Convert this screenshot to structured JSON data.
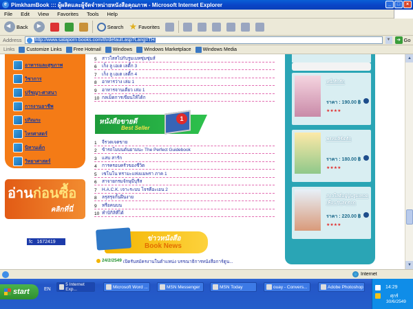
{
  "window": {
    "title": "PimkhamBook ::: ผู้ผลิตและผู้จัดจำหน่ายหนังสือคุณภาพ - Microsoft Internet Explorer"
  },
  "menu": [
    "File",
    "Edit",
    "View",
    "Favorites",
    "Tools",
    "Help"
  ],
  "toolbar": {
    "back": "Back",
    "search": "Search",
    "favorites": "Favorites"
  },
  "address": {
    "label": "Address",
    "url": "http://www.sataporn books.com/th/default.asp?Lang=TH",
    "go": "Go"
  },
  "links": {
    "label": "Links",
    "items": [
      "Customize Links",
      "Free Hotmail",
      "Windows",
      "Windows Marketplace",
      "Windows Media"
    ]
  },
  "categories": [
    "อาหารและสุขภาพ",
    "วิชาการ",
    "ปรัชญา-ศาสนา",
    "การงานอาชีพ",
    "ปกิณกะ",
    "ไหรศาสตร์",
    "นิทานเด็ก",
    "วิทยาศาสตร์"
  ],
  "promo": {
    "big_a": "อ่าน",
    "big_b": "ก่อนซื้อ",
    "sub": "คลิกที่นี่"
  },
  "counter": {
    "icon": "fc",
    "value": "1672419"
  },
  "list_top": [
    {
      "n": "5",
      "t": "สาวใสสไปกับรูมเมทซุ่มซุ่มส์"
    },
    {
      "n": "6",
      "t": "เก็ง ลู เอเต เลดี้ก 3"
    },
    {
      "n": "7",
      "t": "เก็ง ลู เอเต เลดี้ก 4"
    },
    {
      "n": "8",
      "t": "อาหารว่าง เล่ม 1"
    },
    {
      "n": "9",
      "t": "อาหารจานเดียว เล่ม 1"
    },
    {
      "n": "10",
      "t": "กลเม็ดการเขียนให้ได้ก"
    }
  ],
  "bestseller": {
    "title": "หนังสือขายดี",
    "subtitle": "Best Seller",
    "badge": "1"
  },
  "list_best": [
    {
      "n": "1",
      "t": "จีรวดเจตขาย"
    },
    {
      "n": "2",
      "t": "ข้ารถโมบนดันยามนะ The Perfect Guidebook"
    },
    {
      "n": "3",
      "t": "แสบ สารัก"
    },
    {
      "n": "4",
      "t": "การครอบครัวของชีวิต"
    },
    {
      "n": "5",
      "t": "เซโนโน ทรามะแห่งแมพรา ภาค 1"
    },
    {
      "n": "6",
      "t": "สาจายกรมจักษุมีบุรีส"
    },
    {
      "n": "7",
      "t": "H.A.C.K. เจาะระบบ โจรคีอะเอน 2"
    },
    {
      "n": "8",
      "t": "ลรุสรุจกั้นฝืนงาย"
    },
    {
      "n": "9",
      "t": "หรือคนบน"
    },
    {
      "n": "10",
      "t": "ทำบิกิลิที่ได้"
    }
  ],
  "news": {
    "title": "ข่าวหนังสือ",
    "subtitle": "Book News",
    "date": "24/2/2549",
    "text": "เปิดรับสมัครงานในตำแหน่ง บรรณาธิการหนังสือการ์ตูน..."
  },
  "books": [
    {
      "title": "หนึ่งรักรัก",
      "price_label": "ราคา :",
      "price": "190.00 ฿",
      "stars": "★★★★"
    },
    {
      "title": "พรหมลิขิตรัก ",
      "price_label": "ราคา :",
      "price": "180.00 ฿",
      "stars": "★★★★"
    },
    {
      "title": "สาวใสต์อยู่ปูนรูมเทอดเพื่อนรุ่นสุดฮอต",
      "price_label": "ราคา :",
      "price": "220.00 ฿",
      "stars": "★★★★"
    }
  ],
  "status": {
    "zone": "Internet"
  },
  "taskbar": {
    "start": "start",
    "lang": "EN",
    "tasks": [
      "5 Internet Exp...",
      "Microsoft Word ...",
      "MSN Messenger",
      "MSN Today",
      "ouay - Convers...",
      "Adobe Photoshop"
    ],
    "time": "14:29",
    "day": "ศุกร์",
    "date": "30/6/2549"
  },
  "colors": {
    "orange": "#f47b16",
    "teal": "#2aa5b5",
    "green": "#1d9b3a",
    "yellow": "#f3b400",
    "xp_blue": "#245ecb"
  }
}
